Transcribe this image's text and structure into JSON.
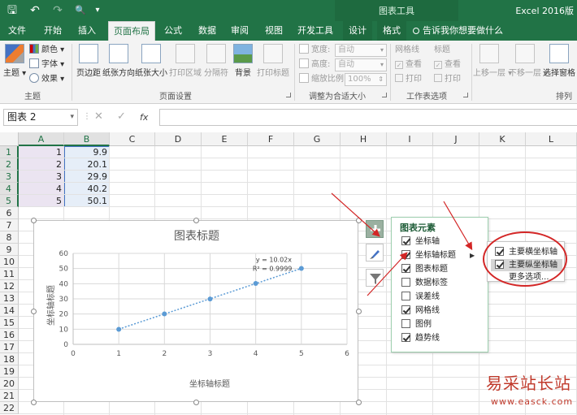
{
  "window": {
    "app_title": "Excel 2016版",
    "tools_label": "图表工具"
  },
  "quick_access": {
    "save": "🖫",
    "undo": "↶",
    "redo": "↷",
    "preview": "🔍",
    "more": "▾"
  },
  "tabs": [
    "文件",
    "开始",
    "插入",
    "页面布局",
    "公式",
    "数据",
    "审阅",
    "视图",
    "开发工具",
    "设计",
    "格式"
  ],
  "tell_me": "告诉我你想要做什么",
  "ribbon": {
    "theme_group": {
      "theme": "主题",
      "colors": "颜色",
      "fonts": "字体",
      "effects": "效果",
      "label": "主题"
    },
    "page_setup": {
      "margins": "页边距",
      "orientation": "纸张方向",
      "size": "纸张大小",
      "print_area": "打印区域",
      "breaks": "分隔符",
      "background": "背景",
      "print_titles": "打印标题",
      "label": "页面设置"
    },
    "scale": {
      "width_label": "宽度:",
      "width_value": "自动",
      "height_label": "高度:",
      "height_value": "自动",
      "scale_label": "缩放比例:",
      "scale_value": "100%",
      "label": "调整为合适大小"
    },
    "sheet_options": {
      "gridlines": "网格线",
      "headings": "标题",
      "view": "查看",
      "print": "打印",
      "label": "工作表选项"
    },
    "arrange": {
      "bring_forward": "上移一层",
      "send_backward": "下移一层",
      "selection_pane": "选择窗格",
      "label": "排列"
    }
  },
  "formula_bar": {
    "name_box": "图表 2",
    "cancel": "✕",
    "enter": "✓",
    "fx": "fx"
  },
  "grid": {
    "columns": [
      "A",
      "B",
      "C",
      "D",
      "E",
      "F",
      "G",
      "H",
      "I",
      "J",
      "K",
      "L"
    ],
    "rows": [
      "1",
      "2",
      "3",
      "4",
      "5",
      "6",
      "7",
      "8",
      "9",
      "10",
      "11",
      "12",
      "13",
      "14",
      "15",
      "16",
      "17",
      "18",
      "19",
      "20",
      "21",
      "22"
    ],
    "col_a": [
      "1",
      "2",
      "3",
      "4",
      "5"
    ],
    "col_b": [
      "9.9",
      "20.1",
      "29.9",
      "40.2",
      "50.1"
    ]
  },
  "chart_data": {
    "type": "scatter",
    "title": "图表标题",
    "xlabel": "坐标轴标题",
    "ylabel": "坐标轴标题",
    "xlim": [
      0,
      6
    ],
    "ylim": [
      0,
      60
    ],
    "xticks": [
      "0",
      "1",
      "2",
      "3",
      "4",
      "5",
      "6"
    ],
    "yticks": [
      "0",
      "10",
      "20",
      "30",
      "40",
      "50",
      "60"
    ],
    "x": [
      1,
      2,
      3,
      4,
      5
    ],
    "y": [
      9.9,
      20.1,
      29.9,
      40.2,
      50.1
    ],
    "trendline": {
      "equation": "y = 10.02x",
      "r2": "R² = 0.9999"
    },
    "grid": true,
    "legend": "none",
    "color": "#5b9bd5"
  },
  "chart_elements": {
    "title": "图表元素",
    "items": [
      {
        "label": "坐标轴",
        "checked": true
      },
      {
        "label": "坐标轴标题",
        "checked": true,
        "submenu": true
      },
      {
        "label": "图表标题",
        "checked": true
      },
      {
        "label": "数据标签",
        "checked": false
      },
      {
        "label": "误差线",
        "checked": false
      },
      {
        "label": "网格线",
        "checked": true
      },
      {
        "label": "图例",
        "checked": false
      },
      {
        "label": "趋势线",
        "checked": true
      }
    ]
  },
  "axis_title_submenu": {
    "items": [
      {
        "label": "主要横坐标轴",
        "checked": true
      },
      {
        "label": "主要纵坐标轴",
        "checked": true
      }
    ],
    "more": "更多选项..."
  },
  "watermark": {
    "main": "易采站长站",
    "sub": "www.easck.com"
  },
  "colors": {
    "accent": "#217346",
    "annotation": "#d32626"
  }
}
